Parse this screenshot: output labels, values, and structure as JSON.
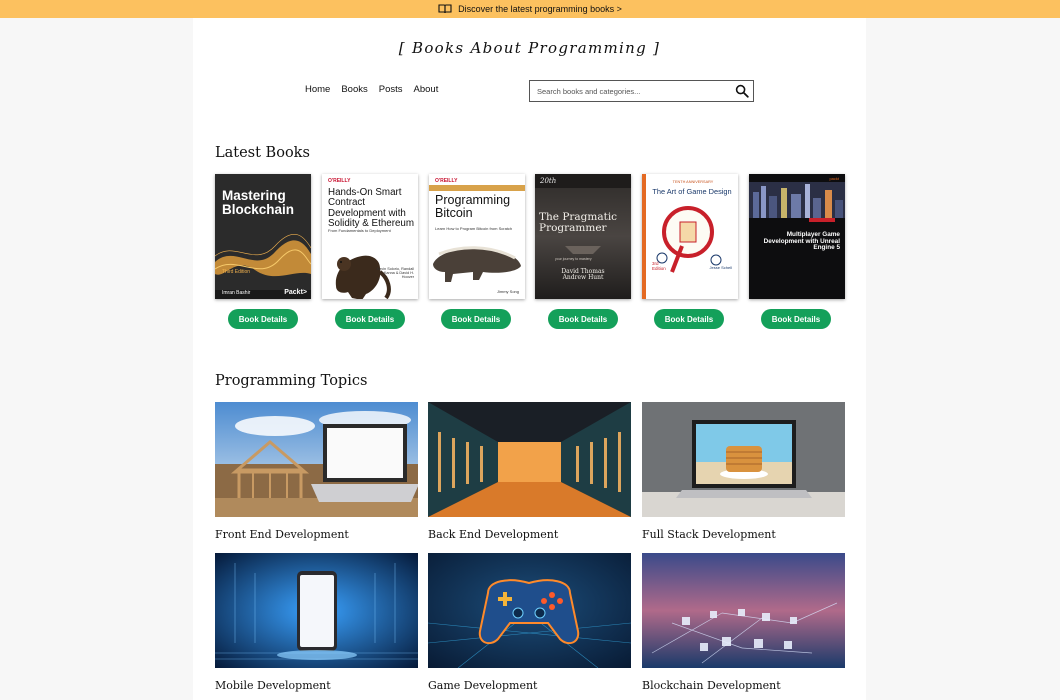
{
  "announcement": {
    "text": "Discover the latest programming books >",
    "icon": "open-book-icon"
  },
  "site": {
    "title": "[ Books About Programming ]"
  },
  "nav": {
    "items": [
      "Home",
      "Books",
      "Posts",
      "About"
    ]
  },
  "search": {
    "placeholder": "Search books and categories...",
    "icon": "search-icon"
  },
  "latest_books": {
    "heading": "Latest Books",
    "button_label": "Book Details",
    "covers": [
      {
        "title": "Mastering Blockchain",
        "edition": "Third Edition",
        "author": "Imran Bashir",
        "publisher": "Packt>"
      },
      {
        "publisher": "O'REILLY",
        "title": "Hands-On Smart Contract Development with Solidity & Ethereum",
        "subtitle": "From Fundamentals to Deployment",
        "authors": "Kevin Solorio, Randall Kanna & David H. Hoover"
      },
      {
        "publisher": "O'REILLY",
        "title": "Programming Bitcoin",
        "subtitle": "Learn How to Program Bitcoin from Scratch",
        "author": "Jimmy Song"
      },
      {
        "badge": "20th",
        "title": "The Pragmatic Programmer",
        "subtitle": "your journey to mastery",
        "authors": "David Thomas\nAndrew Hunt"
      },
      {
        "edition_tag": "TENTH ANNIVERSARY",
        "title": "The Art of Game Design",
        "edition": "3rd Edition",
        "author": "Jesse Schell"
      },
      {
        "publisher": "packt",
        "title": "Multiplayer Game Development with Unreal Engine 5"
      }
    ]
  },
  "topics": {
    "heading": "Programming Topics",
    "items": [
      "Front End Development",
      "Back End Development",
      "Full Stack Development",
      "Mobile Development",
      "Game Development",
      "Blockchain Development"
    ]
  },
  "colors": {
    "announce_bg": "#fcc15f",
    "button_bg": "#14a05a",
    "page_bg": "#f7f7f7"
  }
}
